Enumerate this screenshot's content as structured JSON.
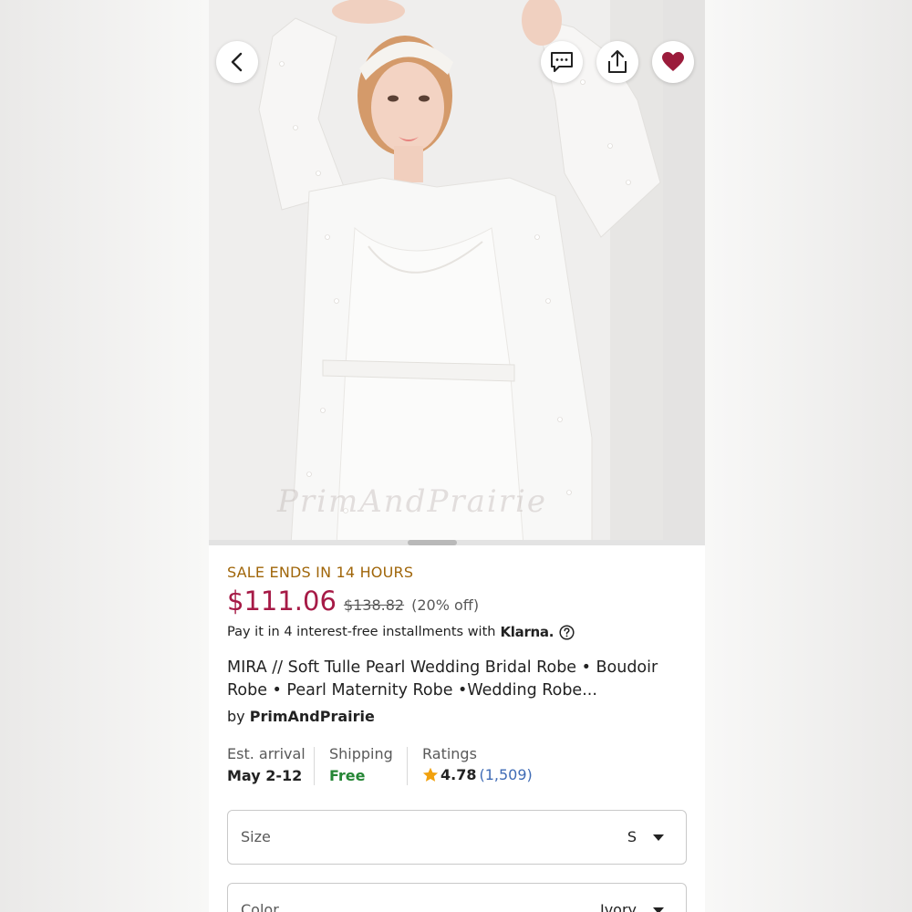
{
  "header": {
    "back_icon": "chevron-left-icon",
    "message_icon": "message-icon",
    "share_icon": "share-icon",
    "favorite_icon": "heart-icon",
    "favorite_color": "#9b1b3b"
  },
  "hero": {
    "watermark": "PrimAndPrairie"
  },
  "product": {
    "sale_notice": "SALE ENDS IN 14 HOURS",
    "price": "$111.06",
    "original_price": "$138.82",
    "discount": "(20% off)",
    "installments_text": "Pay it in 4 interest-free installments with",
    "installments_brand": "Klarna.",
    "title": "MIRA // Soft Tulle Pearl Wedding Bridal Robe • Boudoir Robe • Pearl Maternity Robe •Wedding Robe...",
    "seller_prefix": "by",
    "seller_name": "PrimAndPrairie"
  },
  "details": {
    "arrival_label": "Est. arrival",
    "arrival_value": "May 2-12",
    "shipping_label": "Shipping",
    "shipping_value": "Free",
    "ratings_label": "Ratings",
    "rating_value": "4.78",
    "rating_count": "(1,509)"
  },
  "options": {
    "size_label": "Size",
    "size_value": "S",
    "color_label": "Color",
    "color_value": "Ivory"
  },
  "colors": {
    "price": "#a61a46",
    "sale": "#a0660a",
    "free": "#258635",
    "link": "#3f6bb5",
    "star": "#f1a10d"
  }
}
